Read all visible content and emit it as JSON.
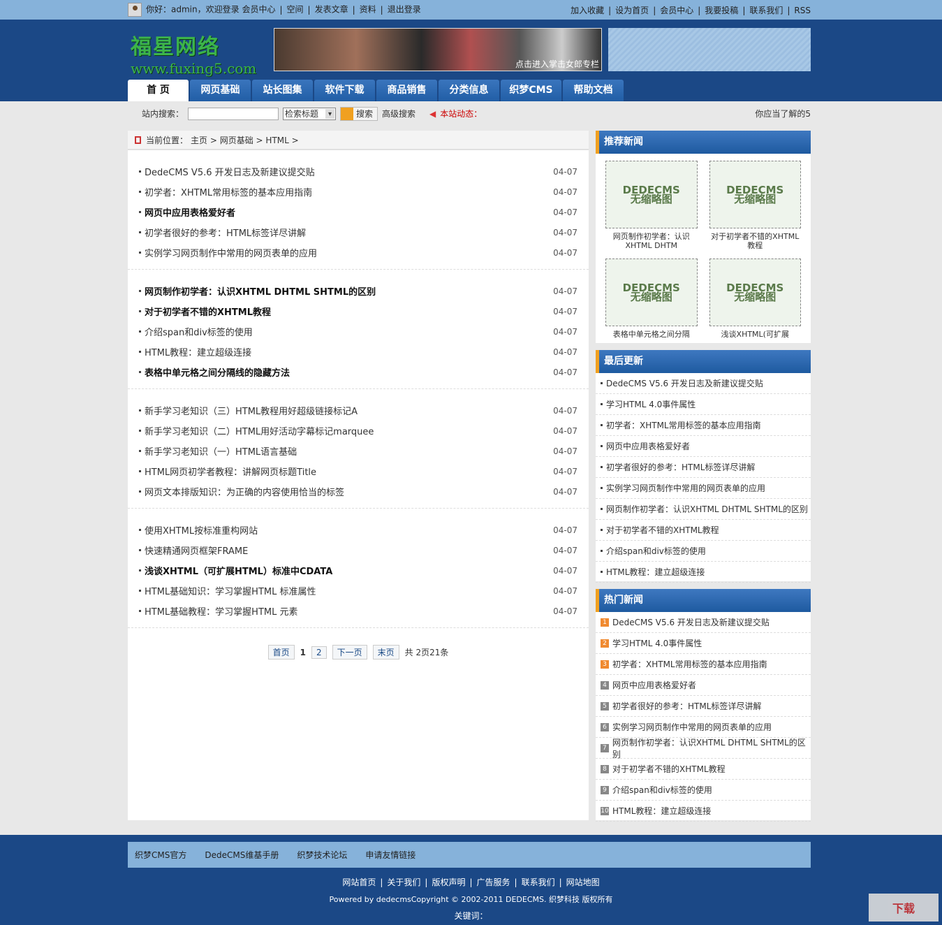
{
  "topbar": {
    "greeting": "你好：admin，欢迎登录",
    "left_links": [
      "会员中心",
      "空间",
      "发表文章",
      "资料",
      "退出登录"
    ],
    "right_links": [
      "加入收藏",
      "设为首页",
      "会员中心",
      "我要投稿",
      "联系我们",
      "RSS"
    ]
  },
  "header": {
    "logo_cn": "福星网络",
    "logo_en": "www.fuxing5.com",
    "banner_caption": "点击进入掌击女郎专栏"
  },
  "nav": [
    "首 页",
    "网页基础",
    "站长图集",
    "软件下载",
    "商品销售",
    "分类信息",
    "织梦CMS",
    "帮助文档"
  ],
  "search": {
    "label": "站内搜索：",
    "value": "",
    "select": "检索标题",
    "button": "搜索",
    "advanced": "高级搜索",
    "news_label": "本站动态：",
    "marquee": "你应当了解的5"
  },
  "breadcrumb": {
    "label": "当前位置：",
    "items": [
      "主页",
      "网页基础",
      "HTML"
    ]
  },
  "articles": [
    [
      {
        "t": "DedeCMS V5.6 开发日志及新建议提交贴",
        "d": "04-07",
        "b": false
      },
      {
        "t": "初学者：XHTML常用标签的基本应用指南",
        "d": "04-07",
        "b": false
      },
      {
        "t": "网页中应用表格爱好者",
        "d": "04-07",
        "b": true
      },
      {
        "t": "初学者很好的参考：HTML标签详尽讲解",
        "d": "04-07",
        "b": false
      },
      {
        "t": "实例学习网页制作中常用的网页表单的应用",
        "d": "04-07",
        "b": false
      }
    ],
    [
      {
        "t": "网页制作初学者：认识XHTML DHTML SHTML的区别",
        "d": "04-07",
        "b": true
      },
      {
        "t": "对于初学者不错的XHTML教程",
        "d": "04-07",
        "b": true
      },
      {
        "t": "介绍span和div标签的使用",
        "d": "04-07",
        "b": false
      },
      {
        "t": "HTML教程：建立超级连接",
        "d": "04-07",
        "b": false
      },
      {
        "t": "表格中单元格之间分隔线的隐藏方法",
        "d": "04-07",
        "b": true
      }
    ],
    [
      {
        "t": "新手学习老知识（三）HTML教程用好超级链接标记A",
        "d": "04-07",
        "b": false
      },
      {
        "t": "新手学习老知识（二）HTML用好活动字幕标记marquee",
        "d": "04-07",
        "b": false
      },
      {
        "t": "新手学习老知识（一）HTML语言基础",
        "d": "04-07",
        "b": false
      },
      {
        "t": "HTML网页初学者教程：讲解网页标题Title",
        "d": "04-07",
        "b": false
      },
      {
        "t": "网页文本排版知识：为正确的内容使用恰当的标签",
        "d": "04-07",
        "b": false
      }
    ],
    [
      {
        "t": "使用XHTML按标准重构网站",
        "d": "04-07",
        "b": false
      },
      {
        "t": "快速精通网页框架FRAME",
        "d": "04-07",
        "b": false
      },
      {
        "t": "浅谈XHTML（可扩展HTML）标准中CDATA",
        "d": "04-07",
        "b": true
      },
      {
        "t": "HTML基础知识：学习掌握HTML 标准属性",
        "d": "04-07",
        "b": false
      },
      {
        "t": "HTML基础教程：学习掌握HTML 元素",
        "d": "04-07",
        "b": false
      }
    ]
  ],
  "pager": {
    "first": "首页",
    "current": "1",
    "page2": "2",
    "next": "下一页",
    "last": "末页",
    "summary": "共 2页21条"
  },
  "recommend": {
    "title": "推荐新闻",
    "placeholder_en": "DEDECMS",
    "placeholder_cn": "无缩略图",
    "items": [
      "网页制作初学者：认识XHTML DHTM",
      "对于初学者不错的XHTML教程",
      "表格中单元格之间分隔",
      "浅谈XHTML(可扩展"
    ]
  },
  "latest": {
    "title": "最后更新",
    "items": [
      "DedeCMS V5.6 开发日志及新建议提交贴",
      "学习HTML 4.0事件属性",
      "初学者：XHTML常用标签的基本应用指南",
      "网页中应用表格爱好者",
      "初学者很好的参考：HTML标签详尽讲解",
      "实例学习网页制作中常用的网页表单的应用",
      "网页制作初学者：认识XHTML DHTML SHTML的区别",
      "对于初学者不错的XHTML教程",
      "介绍span和div标签的使用",
      "HTML教程：建立超级连接"
    ]
  },
  "hot": {
    "title": "热门新闻",
    "items": [
      "DedeCMS V5.6 开发日志及新建议提交贴",
      "学习HTML 4.0事件属性",
      "初学者：XHTML常用标签的基本应用指南",
      "网页中应用表格爱好者",
      "初学者很好的参考：HTML标签详尽讲解",
      "实例学习网页制作中常用的网页表单的应用",
      "网页制作初学者：认识XHTML DHTML SHTML的区别",
      "对于初学者不错的XHTML教程",
      "介绍span和div标签的使用",
      "HTML教程：建立超级连接"
    ]
  },
  "footer": {
    "links": [
      "织梦CMS官方",
      "DedeCMS维基手册",
      "织梦技术论坛",
      "申请友情链接"
    ],
    "nav": [
      "网站首页",
      "关于我们",
      "版权声明",
      "广告服务",
      "联系我们",
      "网站地图"
    ],
    "copyright": "Powered by dedecmsCopyright © 2002-2011 DEDECMS. 织梦科技 版权所有",
    "keywords": "关键词：",
    "watermark": "下载"
  }
}
